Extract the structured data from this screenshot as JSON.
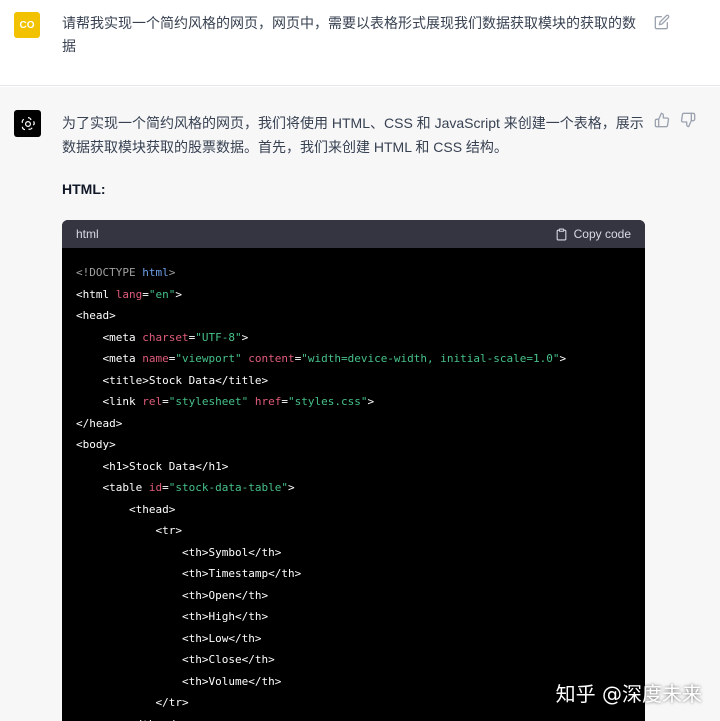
{
  "user_message": {
    "avatar_text": "CO",
    "text": "请帮我实现一个简约风格的网页，网页中，需要以表格形式展现我们数据获取模块的获取的数据"
  },
  "assistant_message": {
    "intro": "为了实现一个简约风格的网页，我们将使用 HTML、CSS 和 JavaScript 来创建一个表格，展示数据获取模块获取的股票数据。首先，我们来创建 HTML 和 CSS 结构。",
    "section_title": "HTML:",
    "code_block": {
      "language": "html",
      "copy_label": "Copy code",
      "lines": [
        "<!DOCTYPE html>",
        "<html lang=\"en\">",
        "<head>",
        "    <meta charset=\"UTF-8\">",
        "    <meta name=\"viewport\" content=\"width=device-width, initial-scale=1.0\">",
        "    <title>Stock Data</title>",
        "    <link rel=\"stylesheet\" href=\"styles.css\">",
        "</head>",
        "<body>",
        "    <h1>Stock Data</h1>",
        "    <table id=\"stock-data-table\">",
        "        <thead>",
        "            <tr>",
        "                <th>Symbol</th>",
        "                <th>Timestamp</th>",
        "                <th>Open</th>",
        "                <th>High</th>",
        "                <th>Low</th>",
        "                <th>Close</th>",
        "                <th>Volume</th>",
        "            </tr>",
        "        </thead>"
      ]
    }
  },
  "watermark": "知乎 @深度未来",
  "colors": {
    "user_avatar": "#f2c200",
    "assistant_bg": "#f7f7f8",
    "code_bg": "#000000",
    "code_header_bg": "#343541"
  },
  "icons": [
    "edit-icon",
    "openai-logo-icon",
    "thumbs-up-icon",
    "thumbs-down-icon",
    "clipboard-icon"
  ]
}
